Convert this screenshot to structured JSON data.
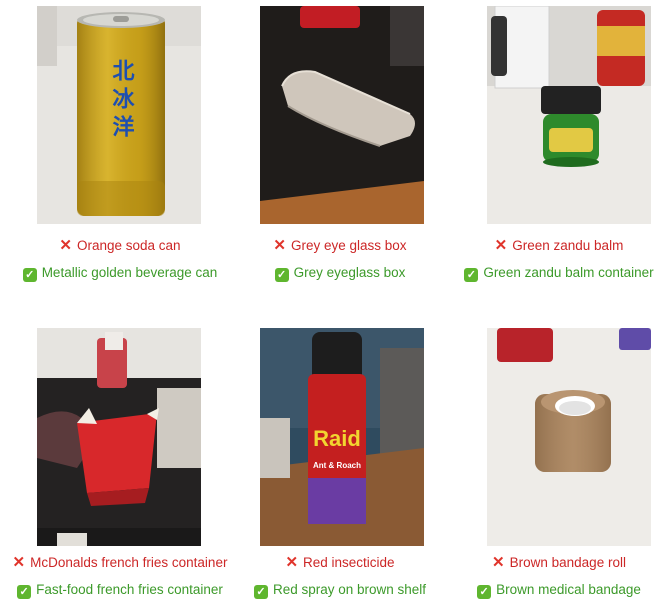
{
  "items": [
    {
      "image_label": "北冰洋",
      "wrong_caption": "Orange soda can",
      "right_caption": "Metallic golden beverage can",
      "wrong_icon": "cross-mark-icon",
      "right_icon": "check-mark-icon"
    },
    {
      "wrong_caption": "Grey eye glass box",
      "right_caption": "Grey eyeglass box",
      "wrong_icon": "cross-mark-icon",
      "right_icon": "check-mark-icon"
    },
    {
      "wrong_caption": "Green zandu balm",
      "right_caption": "Green zandu balm container",
      "wrong_icon": "cross-mark-icon",
      "right_icon": "check-mark-icon"
    },
    {
      "wrong_caption": "McDonalds french fries container",
      "right_caption": "Fast-food french fries container",
      "wrong_icon": "cross-mark-icon",
      "right_icon": "check-mark-icon"
    },
    {
      "image_label": "Raid",
      "image_sublabel": "Ant & Roach",
      "wrong_caption": "Red insecticide",
      "right_caption": "Red spray on brown shelf",
      "wrong_icon": "cross-mark-icon",
      "right_icon": "check-mark-icon"
    },
    {
      "wrong_caption": "Brown bandage roll",
      "right_caption": "Brown medical bandage",
      "wrong_icon": "cross-mark-icon",
      "right_icon": "check-mark-icon"
    }
  ],
  "colors": {
    "wrong_text": "#cc2727",
    "right_text": "#3c9a2a",
    "cross_mark": "#e0342b",
    "check_mark_bg": "#5fb62f"
  }
}
